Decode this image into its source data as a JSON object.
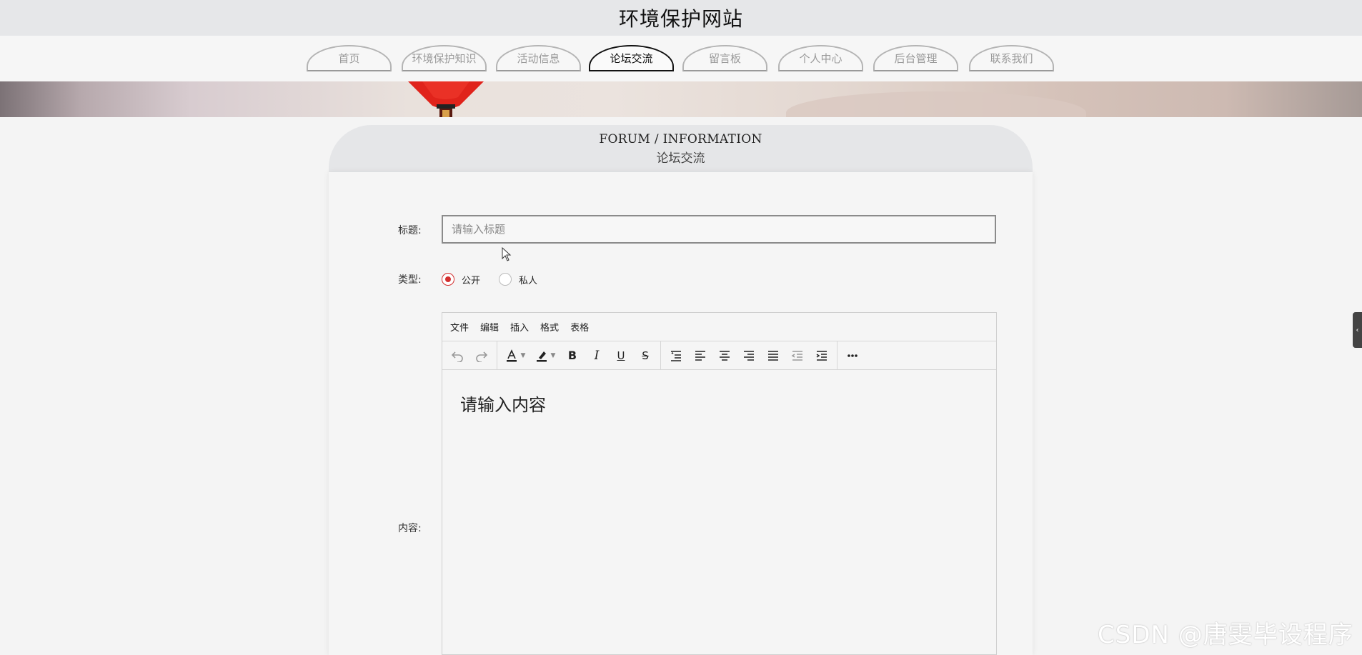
{
  "header": {
    "title": "环境保护网站"
  },
  "nav": {
    "items": [
      {
        "label": "首页",
        "active": false
      },
      {
        "label": "环境保护知识",
        "active": false
      },
      {
        "label": "活动信息",
        "active": false
      },
      {
        "label": "论坛交流",
        "active": true
      },
      {
        "label": "留言板",
        "active": false
      },
      {
        "label": "个人中心",
        "active": false
      },
      {
        "label": "后台管理",
        "active": false
      },
      {
        "label": "联系我们",
        "active": false
      }
    ]
  },
  "panel": {
    "title_en": "FORUM / INFORMATION",
    "title_cn": "论坛交流"
  },
  "form": {
    "title_label": "标题:",
    "title_placeholder": "请输入标题",
    "title_value": "",
    "type_label": "类型:",
    "type_options": [
      {
        "label": "公开",
        "checked": true
      },
      {
        "label": "私人",
        "checked": false
      }
    ],
    "content_label": "内容:"
  },
  "editor": {
    "menu": [
      "文件",
      "编辑",
      "插入",
      "格式",
      "表格"
    ],
    "placeholder": "请输入内容",
    "toolbar_icons": [
      "undo-icon",
      "redo-icon",
      "text-color-icon",
      "highlight-color-icon",
      "bold-icon",
      "italic-icon",
      "underline-icon",
      "strikethrough-icon",
      "line-height-icon",
      "align-left-icon",
      "align-center-icon",
      "align-right-icon",
      "align-justify-icon",
      "outdent-icon",
      "indent-icon",
      "more-icon"
    ],
    "accent_color": "#d32f2f"
  },
  "watermark": "CSDN @唐雯毕设程序"
}
